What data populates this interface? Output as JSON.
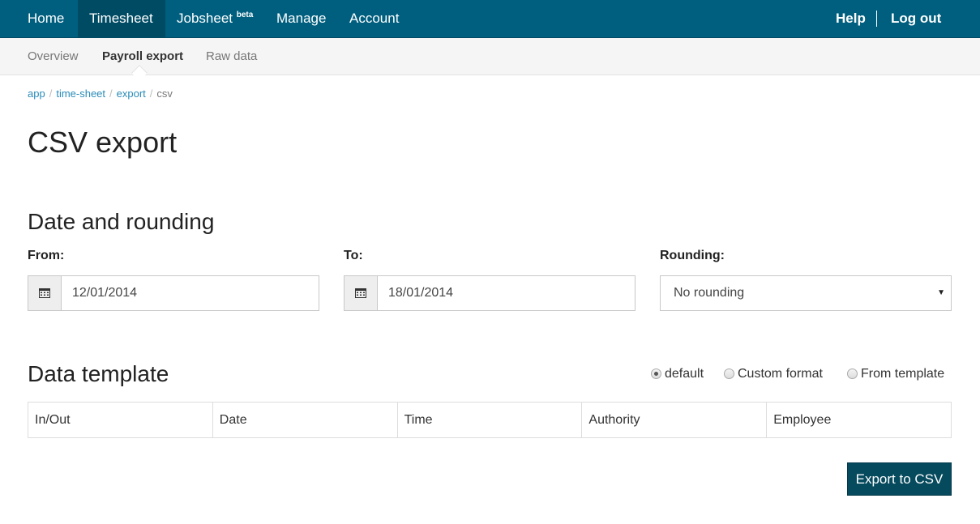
{
  "topnav": {
    "home": "Home",
    "timesheet": "Timesheet",
    "jobsheet": "Jobsheet",
    "jobsheet_badge": "beta",
    "manage": "Manage",
    "account": "Account",
    "help": "Help",
    "logout": "Log out"
  },
  "subnav": {
    "overview": "Overview",
    "payroll_export": "Payroll export",
    "raw_data": "Raw data"
  },
  "breadcrumb": {
    "items": [
      "app",
      "time-sheet",
      "export"
    ],
    "current": "csv",
    "separator": "/"
  },
  "page": {
    "title": "CSV export"
  },
  "date_section": {
    "heading": "Date and rounding",
    "from_label": "From:",
    "from_value": "12/01/2014",
    "to_label": "To:",
    "to_value": "18/01/2014",
    "rounding_label": "Rounding:",
    "rounding_value": "No rounding"
  },
  "template_section": {
    "heading": "Data template",
    "radios": [
      {
        "label": "default",
        "checked": true
      },
      {
        "label": "Custom format",
        "checked": false
      },
      {
        "label": "From template",
        "checked": false
      }
    ],
    "columns": [
      "In/Out",
      "Date",
      "Time",
      "Authority",
      "Employee"
    ]
  },
  "actions": {
    "export_label": "Export to CSV"
  },
  "colors": {
    "nav_bg": "#005f7f",
    "nav_active": "#004b64",
    "link": "#2a8bb8",
    "button": "#064a5e"
  }
}
